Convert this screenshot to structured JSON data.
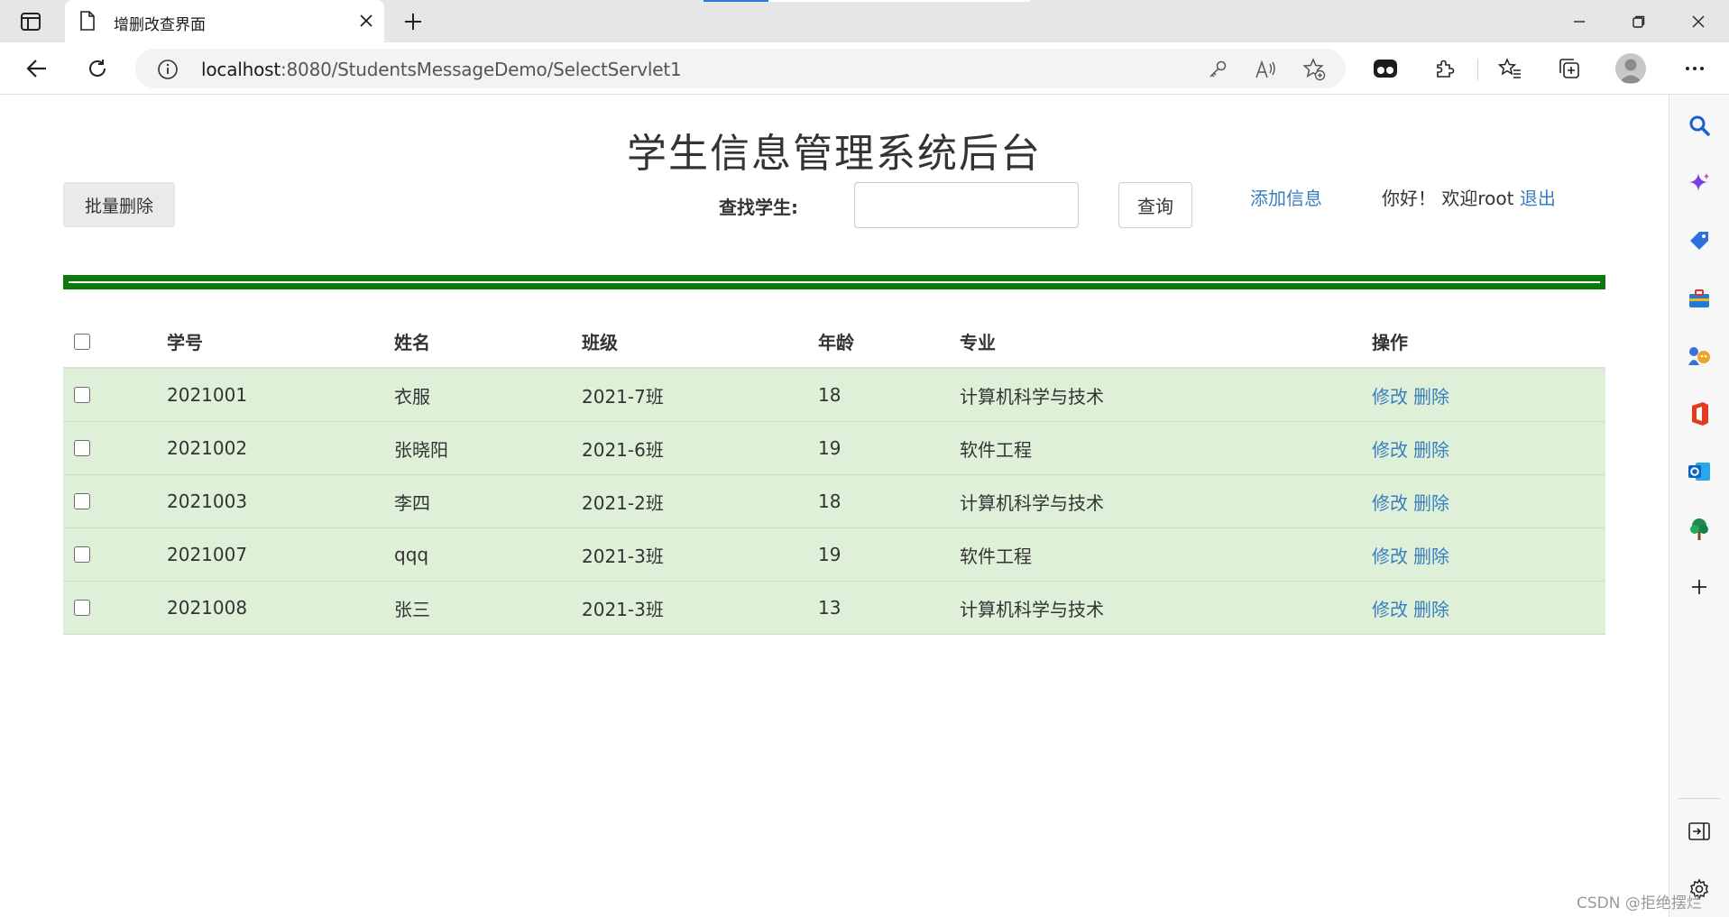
{
  "browser": {
    "tab_title": "增删改查界面",
    "url_host": "localhost",
    "url_rest": ":8080/StudentsMessageDemo/SelectServlet1"
  },
  "page": {
    "title": "学生信息管理系统后台",
    "batch_delete_label": "批量删除",
    "search_label": "查找学生:",
    "search_value": "",
    "query_label": "查询",
    "add_label": "添加信息",
    "welcome_text": "你好！ 欢迎root",
    "logout_label": "退出"
  },
  "table": {
    "headers": [
      "学号",
      "姓名",
      "班级",
      "年龄",
      "专业",
      "操作"
    ],
    "edit_label": "修改",
    "delete_label": "删除",
    "rows": [
      {
        "id": "2021001",
        "name": "衣服",
        "class": "2021-7班",
        "age": "18",
        "major": "计算机科学与技术"
      },
      {
        "id": "2021002",
        "name": "张晓阳",
        "class": "2021-6班",
        "age": "19",
        "major": "软件工程"
      },
      {
        "id": "2021003",
        "name": "李四",
        "class": "2021-2班",
        "age": "18",
        "major": "计算机科学与技术"
      },
      {
        "id": "2021007",
        "name": "qqq",
        "class": "2021-3班",
        "age": "19",
        "major": "软件工程"
      },
      {
        "id": "2021008",
        "name": "张三",
        "class": "2021-3班",
        "age": "13",
        "major": "计算机科学与技术"
      }
    ]
  },
  "watermark": "CSDN @拒绝摆烂",
  "colors": {
    "accent_link": "#3a7ebf",
    "divider_green": "#0a7a0a",
    "row_green": "#dff0d8"
  }
}
